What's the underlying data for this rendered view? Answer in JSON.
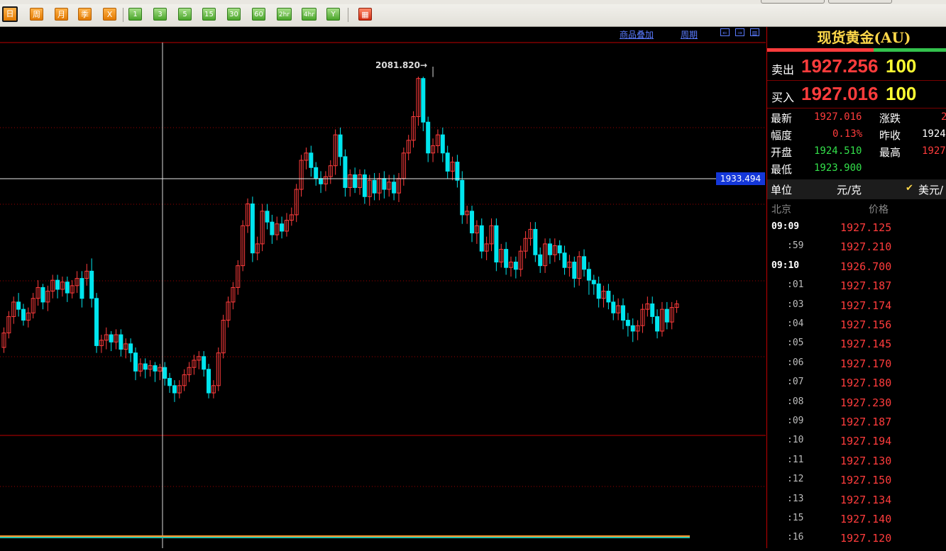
{
  "toolbar": {
    "buttons": [
      {
        "label": "日",
        "style": "orange",
        "active": true
      },
      {
        "label": "周",
        "style": "orange"
      },
      {
        "label": "月",
        "style": "orange"
      },
      {
        "label": "季",
        "style": "orange"
      },
      {
        "label": "X",
        "style": "orange"
      },
      {
        "label": "1",
        "style": "green"
      },
      {
        "label": "3",
        "style": "green"
      },
      {
        "label": "5",
        "style": "green"
      },
      {
        "label": "15",
        "style": "green"
      },
      {
        "label": "30",
        "style": "green"
      },
      {
        "label": "60",
        "style": "green"
      },
      {
        "label": "2hr",
        "style": "green"
      },
      {
        "label": "4hr",
        "style": "green"
      },
      {
        "label": "Y",
        "style": "green"
      },
      {
        "label": "▦",
        "style": "red"
      }
    ]
  },
  "chart_menu": {
    "overlay_label": "商品叠加",
    "period_label": "周期"
  },
  "colors": {
    "up": "#ff3c3c",
    "down": "#00e5ee",
    "grid": "#a00000",
    "price_tag_bg": "#1437d9"
  },
  "chart_data": {
    "type": "candlestick",
    "ylim": [
      1885,
      2100
    ],
    "current_price_label": "1933.494",
    "high_marker": "2081.820→",
    "high_value": 2081.82,
    "candles": [
      [
        1933,
        1941,
        1930,
        1944
      ],
      [
        1941,
        1950,
        1938,
        1953
      ],
      [
        1950,
        1958,
        1946,
        1961
      ],
      [
        1958,
        1954,
        1950,
        1963
      ],
      [
        1954,
        1948,
        1945,
        1957
      ],
      [
        1948,
        1952,
        1944,
        1955
      ],
      [
        1952,
        1960,
        1949,
        1963
      ],
      [
        1960,
        1966,
        1956,
        1970
      ],
      [
        1966,
        1958,
        1954,
        1968
      ],
      [
        1958,
        1964,
        1953,
        1967
      ],
      [
        1964,
        1970,
        1960,
        1973
      ],
      [
        1970,
        1965,
        1960,
        1973
      ],
      [
        1965,
        1969,
        1961,
        1972
      ],
      [
        1969,
        1963,
        1958,
        1972
      ],
      [
        1963,
        1967,
        1960,
        1970
      ],
      [
        1967,
        1971,
        1963,
        1975
      ],
      [
        1971,
        1960,
        1955,
        1975
      ],
      [
        1971,
        1975,
        1967,
        1979
      ],
      [
        1975,
        1960,
        1955,
        1982
      ],
      [
        1960,
        1934,
        1930,
        1963
      ],
      [
        1934,
        1937,
        1930,
        1940
      ],
      [
        1937,
        1940,
        1932,
        1944
      ],
      [
        1940,
        1936,
        1931,
        1942
      ],
      [
        1936,
        1940,
        1932,
        1943
      ],
      [
        1940,
        1932,
        1928,
        1943
      ],
      [
        1932,
        1935,
        1927,
        1938
      ],
      [
        1935,
        1930,
        1925,
        1938
      ],
      [
        1930,
        1920,
        1915,
        1933
      ],
      [
        1920,
        1924,
        1917,
        1927
      ],
      [
        1924,
        1921,
        1916,
        1927
      ],
      [
        1921,
        1923,
        1917,
        1926
      ],
      [
        1923,
        1920,
        1914,
        1925
      ],
      [
        1920,
        1922,
        1915,
        1924
      ],
      [
        1922,
        1916,
        1912,
        1925
      ],
      [
        1916,
        1912,
        1908,
        1919
      ],
      [
        1912,
        1908,
        1903,
        1915
      ],
      [
        1908,
        1912,
        1905,
        1915
      ],
      [
        1912,
        1918,
        1909,
        1921
      ],
      [
        1918,
        1922,
        1914,
        1925
      ],
      [
        1922,
        1926,
        1918,
        1929
      ],
      [
        1926,
        1928,
        1921,
        1931
      ],
      [
        1928,
        1921,
        1917,
        1931
      ],
      [
        1921,
        1908,
        1905,
        1924
      ],
      [
        1908,
        1912,
        1905,
        1915
      ],
      [
        1912,
        1930,
        1909,
        1933
      ],
      [
        1930,
        1948,
        1927,
        1951
      ],
      [
        1948,
        1958,
        1944,
        1961
      ],
      [
        1958,
        1966,
        1954,
        1969
      ],
      [
        1966,
        1978,
        1962,
        1981
      ],
      [
        1978,
        2000,
        1975,
        2003
      ],
      [
        2000,
        2012,
        1996,
        2015
      ],
      [
        2012,
        1985,
        1980,
        2016
      ],
      [
        1985,
        1990,
        1981,
        1994
      ],
      [
        1990,
        2008,
        1986,
        2012
      ],
      [
        2008,
        2002,
        1998,
        2012
      ],
      [
        2002,
        1995,
        1990,
        2006
      ],
      [
        1995,
        2001,
        1992,
        2005
      ],
      [
        2001,
        1997,
        1993,
        2005
      ],
      [
        1997,
        2003,
        1994,
        2007
      ],
      [
        2003,
        2006,
        2000,
        2010
      ],
      [
        2006,
        2020,
        2002,
        2023
      ],
      [
        2020,
        2036,
        2016,
        2039
      ],
      [
        2036,
        2040,
        2031,
        2043
      ],
      [
        2040,
        2032,
        2027,
        2044
      ],
      [
        2032,
        2026,
        2022,
        2035
      ],
      [
        2026,
        2023,
        2018,
        2030
      ],
      [
        2023,
        2027,
        2019,
        2030
      ],
      [
        2027,
        2033,
        2023,
        2036
      ],
      [
        2033,
        2050,
        2028,
        2053
      ],
      [
        2050,
        2038,
        2033,
        2054
      ],
      [
        2038,
        2021,
        2016,
        2042
      ],
      [
        2021,
        2028,
        2016,
        2031
      ],
      [
        2028,
        2021,
        2018,
        2032
      ],
      [
        2021,
        2028,
        2017,
        2031
      ],
      [
        2028,
        2016,
        2012,
        2031
      ],
      [
        2016,
        2025,
        2011,
        2028
      ],
      [
        2025,
        2018,
        2014,
        2029
      ],
      [
        2018,
        2026,
        2014,
        2029
      ],
      [
        2026,
        2020,
        2015,
        2030
      ],
      [
        2020,
        2024,
        2016,
        2028
      ],
      [
        2024,
        2018,
        2014,
        2028
      ],
      [
        2018,
        2026,
        2013,
        2029
      ],
      [
        2026,
        2040,
        2022,
        2043
      ],
      [
        2040,
        2047,
        2036,
        2050
      ],
      [
        2047,
        2060,
        2043,
        2063
      ],
      [
        2060,
        2081,
        2055,
        2082
      ],
      [
        2081,
        2057,
        2052,
        2082
      ],
      [
        2057,
        2040,
        2035,
        2060
      ],
      [
        2040,
        2044,
        2035,
        2048
      ],
      [
        2044,
        2050,
        2040,
        2053
      ],
      [
        2050,
        2040,
        2035,
        2054
      ],
      [
        2040,
        2030,
        2026,
        2044
      ],
      [
        2030,
        2035,
        2025,
        2038
      ],
      [
        2035,
        2025,
        2021,
        2039
      ],
      [
        2025,
        2006,
        2001,
        2030
      ],
      [
        2006,
        2008,
        2001,
        2011
      ],
      [
        2008,
        1996,
        1991,
        2011
      ],
      [
        1996,
        2000,
        1990,
        2003
      ],
      [
        2000,
        1986,
        1982,
        2004
      ],
      [
        1986,
        1990,
        1981,
        1994
      ],
      [
        1990,
        2000,
        1986,
        2004
      ],
      [
        2000,
        1980,
        1975,
        2004
      ],
      [
        1980,
        1987,
        1977,
        1990
      ],
      [
        1987,
        1977,
        1973,
        1991
      ],
      [
        1977,
        1980,
        1972,
        1983
      ],
      [
        1980,
        1976,
        1971,
        1983
      ],
      [
        1976,
        1986,
        1972,
        1989
      ],
      [
        1986,
        1993,
        1982,
        1997
      ],
      [
        1993,
        1998,
        1989,
        2002
      ],
      [
        1998,
        1984,
        1980,
        2002
      ],
      [
        1984,
        1978,
        1974,
        1988
      ],
      [
        1978,
        1990,
        1974,
        1993
      ],
      [
        1990,
        1984,
        1979,
        1993
      ],
      [
        1984,
        1989,
        1980,
        1993
      ],
      [
        1989,
        1985,
        1981,
        1992
      ],
      [
        1985,
        1977,
        1973,
        1989
      ],
      [
        1977,
        1980,
        1972,
        1984
      ],
      [
        1980,
        1971,
        1966,
        1983
      ],
      [
        1971,
        1983,
        1967,
        1986
      ],
      [
        1983,
        1976,
        1972,
        1987
      ],
      [
        1976,
        1970,
        1962,
        1980
      ],
      [
        1970,
        1968,
        1962,
        1973
      ],
      [
        1968,
        1960,
        1955,
        1972
      ],
      [
        1960,
        1964,
        1955,
        1967
      ],
      [
        1964,
        1958,
        1954,
        1968
      ],
      [
        1958,
        1952,
        1948,
        1962
      ],
      [
        1952,
        1956,
        1948,
        1960
      ],
      [
        1956,
        1948,
        1943,
        1960
      ],
      [
        1948,
        1945,
        1939,
        1952
      ],
      [
        1945,
        1942,
        1936,
        1949
      ],
      [
        1942,
        1945,
        1937,
        1948
      ],
      [
        1945,
        1954,
        1941,
        1957
      ],
      [
        1954,
        1957,
        1950,
        1961
      ],
      [
        1957,
        1950,
        1946,
        1961
      ],
      [
        1950,
        1942,
        1938,
        1954
      ],
      [
        1942,
        1954,
        1939,
        1958
      ],
      [
        1954,
        1947,
        1943,
        1958
      ],
      [
        1947,
        1955,
        1943,
        1958
      ],
      [
        1955,
        1957,
        1952,
        1959
      ]
    ]
  },
  "panel": {
    "title": "现货黄金(AU)",
    "sell_label": "卖出",
    "sell_price": "1927.256",
    "sell_vol": "100",
    "buy_label": "买入",
    "buy_price": "1927.016",
    "buy_vol": "100",
    "stats": {
      "latest_label": "最新",
      "latest_value": "1927.016",
      "change_label": "涨跌",
      "change_value": "2",
      "range_label": "幅度",
      "range_value": "0.13%",
      "prev_close_label": "昨收",
      "prev_close_value": "1924",
      "open_label": "开盘",
      "open_value": "1924.510",
      "high_label": "最高",
      "high_value": "1927",
      "low_label": "最低",
      "low_value": "1923.900"
    },
    "unit_label": "单位",
    "unit_value": "元/克",
    "currency_option": "美元/",
    "ticks_header_time": "北京",
    "ticks_header_price": "价格",
    "ticks": [
      {
        "time": "09:09",
        "price": "1927.125",
        "bold": true
      },
      {
        "time": ":59",
        "price": "1927.210"
      },
      {
        "time": "09:10",
        "price": "1926.700",
        "bold": true
      },
      {
        "time": ":01",
        "price": "1927.187"
      },
      {
        "time": ":03",
        "price": "1927.174"
      },
      {
        "time": ":04",
        "price": "1927.156"
      },
      {
        "time": ":05",
        "price": "1927.145"
      },
      {
        "time": ":06",
        "price": "1927.170"
      },
      {
        "time": ":07",
        "price": "1927.180"
      },
      {
        "time": ":08",
        "price": "1927.230"
      },
      {
        "time": ":09",
        "price": "1927.187"
      },
      {
        "time": ":10",
        "price": "1927.194"
      },
      {
        "time": ":11",
        "price": "1927.130"
      },
      {
        "time": ":12",
        "price": "1927.150"
      },
      {
        "time": ":13",
        "price": "1927.134"
      },
      {
        "time": ":15",
        "price": "1927.140"
      },
      {
        "time": ":16",
        "price": "1927.120"
      }
    ]
  }
}
